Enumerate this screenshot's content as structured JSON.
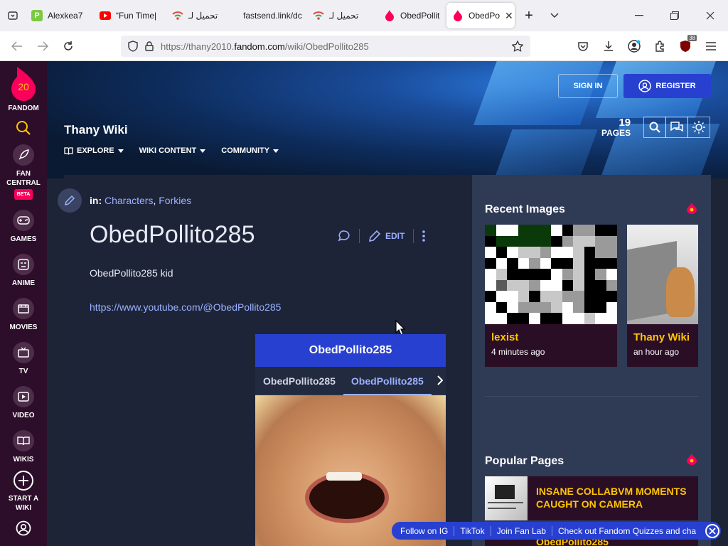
{
  "browser": {
    "tabs": [
      {
        "label": "Alexkea7",
        "icon": "p-icon"
      },
      {
        "label": "“Fun Time|",
        "icon": "youtube-icon"
      },
      {
        "label": "تحميل لـ",
        "icon": "wifi-icon"
      },
      {
        "label": "fastsend.link/dc",
        "icon": "none"
      },
      {
        "label": "تحميل لـ",
        "icon": "wifi-icon"
      },
      {
        "label": "ObedPollit",
        "icon": "fandom-icon"
      },
      {
        "label": "ObedPo",
        "icon": "fandom-icon",
        "active": true
      }
    ],
    "url_prefix": "https://thany2010.",
    "url_domain": "fandom.com",
    "url_path": "/wiki/ObedPollito285",
    "extension_badge": "38"
  },
  "fandom_nav": {
    "logo_label": "FANDOM",
    "logo_number": "20",
    "items": [
      {
        "label": "FAN CENTRAL",
        "badge": "BETA",
        "icon": "rocket-icon"
      },
      {
        "label": "GAMES",
        "icon": "gamepad-icon"
      },
      {
        "label": "ANIME",
        "icon": "anime-icon"
      },
      {
        "label": "MOVIES",
        "icon": "film-icon"
      },
      {
        "label": "TV",
        "icon": "tv-icon"
      },
      {
        "label": "VIDEO",
        "icon": "video-icon"
      },
      {
        "label": "WIKIS",
        "icon": "book-icon"
      },
      {
        "label": "START A WIKI",
        "icon": "plus-icon"
      }
    ]
  },
  "header": {
    "wiki_name": "Thany Wiki",
    "nav": [
      "EXPLORE",
      "WIKI CONTENT",
      "COMMUNITY"
    ],
    "sign_in": "SIGN IN",
    "register": "REGISTER",
    "pages_count": "19",
    "pages_label": "PAGES"
  },
  "article": {
    "in_label": "in:",
    "categories": [
      "Characters",
      "Forkies"
    ],
    "title": "ObedPollito285",
    "edit_label": "EDIT",
    "body": "ObedPollito285 kid",
    "link": "https://www.youtube.com/@ObedPollito285"
  },
  "infobox": {
    "title": "ObedPollito285",
    "tabs": [
      "ObedPollito285",
      "ObedPollito285"
    ]
  },
  "rail": {
    "recent_images_title": "Recent Images",
    "recent_images": [
      {
        "caption": "lexist",
        "time": "4 minutes ago"
      },
      {
        "caption": "Thany Wiki",
        "time": "an hour ago"
      }
    ],
    "popular_title": "Popular Pages",
    "popular": [
      "INSANE COLLABVM MOMENTS CAUGHT ON CAMERA",
      "ObedPollito285"
    ]
  },
  "banner": {
    "links": [
      "Follow on IG",
      "TikTok",
      "Join Fan Lab",
      "Check out Fandom Quizzes and cha"
    ]
  },
  "colors": {
    "fandom_nav": "#2c0d2a",
    "accent_blue": "#2840d0",
    "link": "#9bb0ff",
    "rail_caption": "#ffc500"
  }
}
